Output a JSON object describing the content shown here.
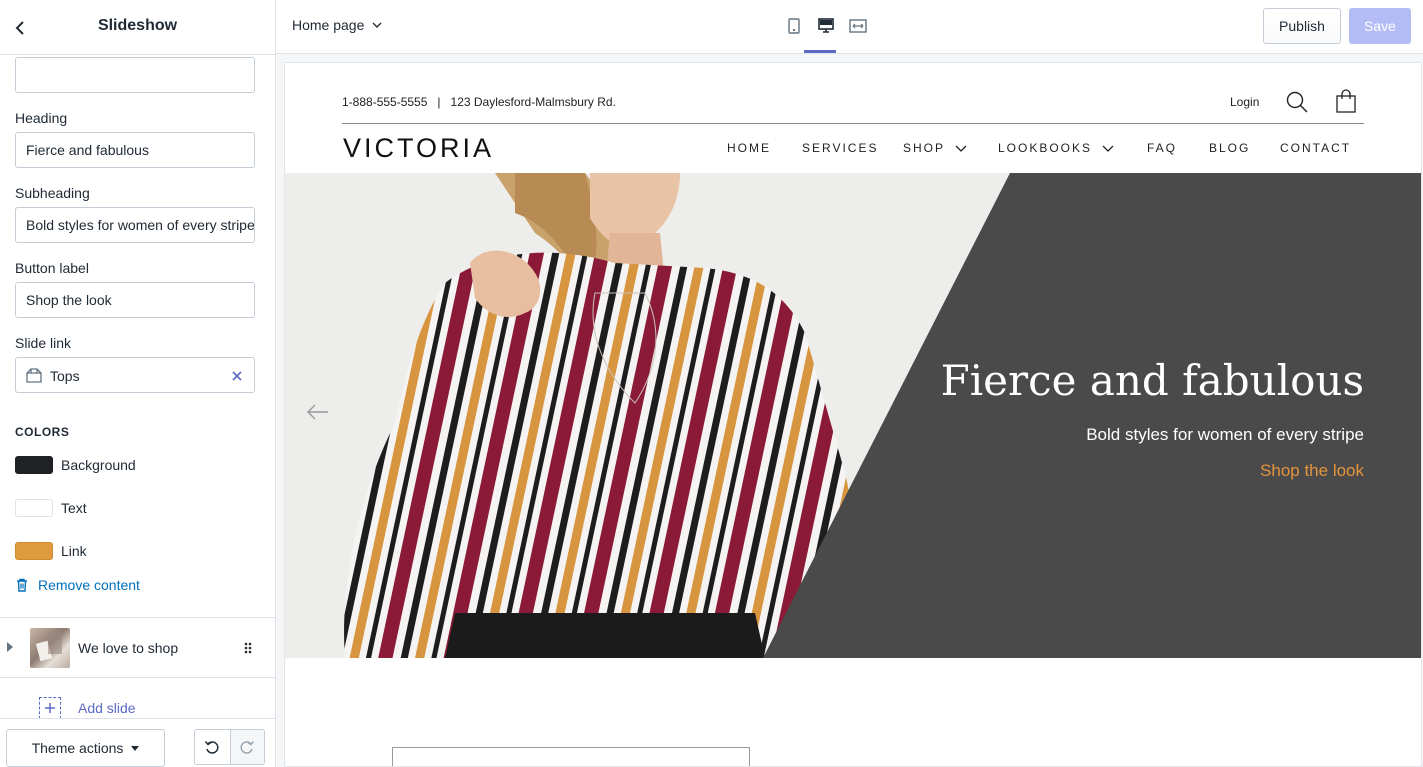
{
  "sidebar": {
    "title": "Slideshow",
    "fields": {
      "heading_label": "Heading",
      "heading_value": "Fierce and fabulous",
      "subheading_label": "Subheading",
      "subheading_value": "Bold styles for women of every stripe",
      "button_label_label": "Button label",
      "button_label_value": "Shop the look",
      "slide_link_label": "Slide link",
      "slide_link_value": "Tops"
    },
    "colors": {
      "heading": "COLORS",
      "items": [
        {
          "label": "Background",
          "hex": "#1f2125"
        },
        {
          "label": "Text",
          "hex": "#ffffff"
        },
        {
          "label": "Link",
          "hex": "#e09a3e"
        }
      ]
    },
    "remove_label": "Remove content",
    "slide_item": "We love to shop",
    "add_slide": "Add slide",
    "footer": {
      "theme_actions": "Theme actions"
    }
  },
  "topbar": {
    "page": "Home page",
    "publish": "Publish",
    "save": "Save",
    "active_view": "desktop"
  },
  "store": {
    "contact": "1-888-555-5555   |   123 Daylesford-Malmsbury Rd.",
    "login": "Login",
    "logo": "VICTORIA",
    "nav": [
      "HOME",
      "SERVICES",
      "SHOP",
      "LOOKBOOKS",
      "FAQ",
      "BLOG",
      "CONTACT"
    ],
    "hero": {
      "title": "Fierce and fabulous",
      "subtitle": "Bold styles for women of every stripe",
      "link": "Shop the look"
    }
  },
  "accent": "#5c6ac4"
}
